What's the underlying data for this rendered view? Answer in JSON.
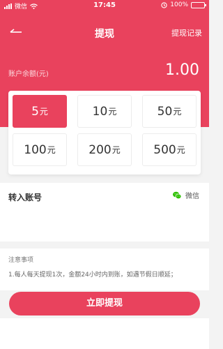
{
  "status_bar": {
    "carrier": "微信",
    "time": "17:45",
    "battery": "100%"
  },
  "nav": {
    "title": "提现",
    "record_link": "提现记录"
  },
  "balance": {
    "label": "账户余额(元)",
    "value": "1.00"
  },
  "amounts": [
    {
      "value": "5",
      "unit": "元",
      "selected": true
    },
    {
      "value": "10",
      "unit": "元",
      "selected": false
    },
    {
      "value": "50",
      "unit": "元",
      "selected": false
    },
    {
      "value": "100",
      "unit": "元",
      "selected": false
    },
    {
      "value": "200",
      "unit": "元",
      "selected": false
    },
    {
      "value": "500",
      "unit": "元",
      "selected": false
    }
  ],
  "account": {
    "label": "转入账号",
    "method": "微信"
  },
  "notes": {
    "title": "注意事项",
    "text": "1.每人每天提现1次，金额24小时内到账，如遇节假日顺延；"
  },
  "submit_label": "立即提现",
  "colors": {
    "accent": "#e9425d",
    "wechat": "#2dc100"
  },
  "icons": {
    "back": "back-arrow-icon",
    "wechat": "wechat-icon",
    "wifi": "wifi-icon",
    "battery": "battery-icon"
  }
}
